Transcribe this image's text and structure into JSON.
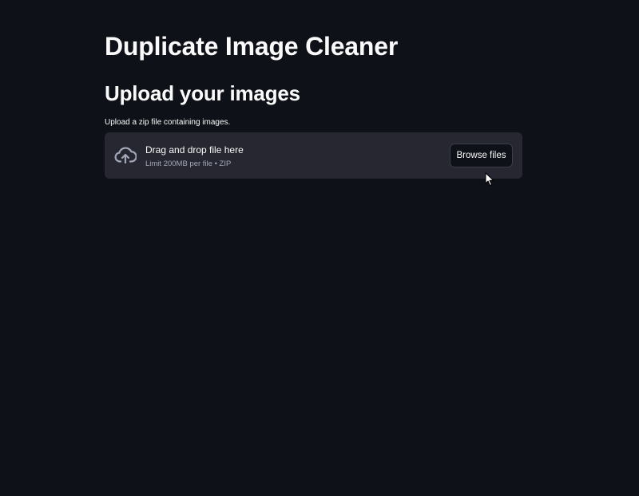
{
  "app": {
    "title": "Duplicate Image Cleaner"
  },
  "main": {
    "section_title": "Upload your images",
    "uploader": {
      "label": "Upload a zip file containing images.",
      "instructions": "Drag and drop file here",
      "limit_text": "Limit 200MB per file • ZIP",
      "browse_label": "Browse files",
      "icon": "cloud-upload-icon"
    }
  },
  "colors": {
    "background": "#0e1117",
    "dropzone": "#262730",
    "text": "#fafafa",
    "muted_text": "#a3a8b8"
  }
}
